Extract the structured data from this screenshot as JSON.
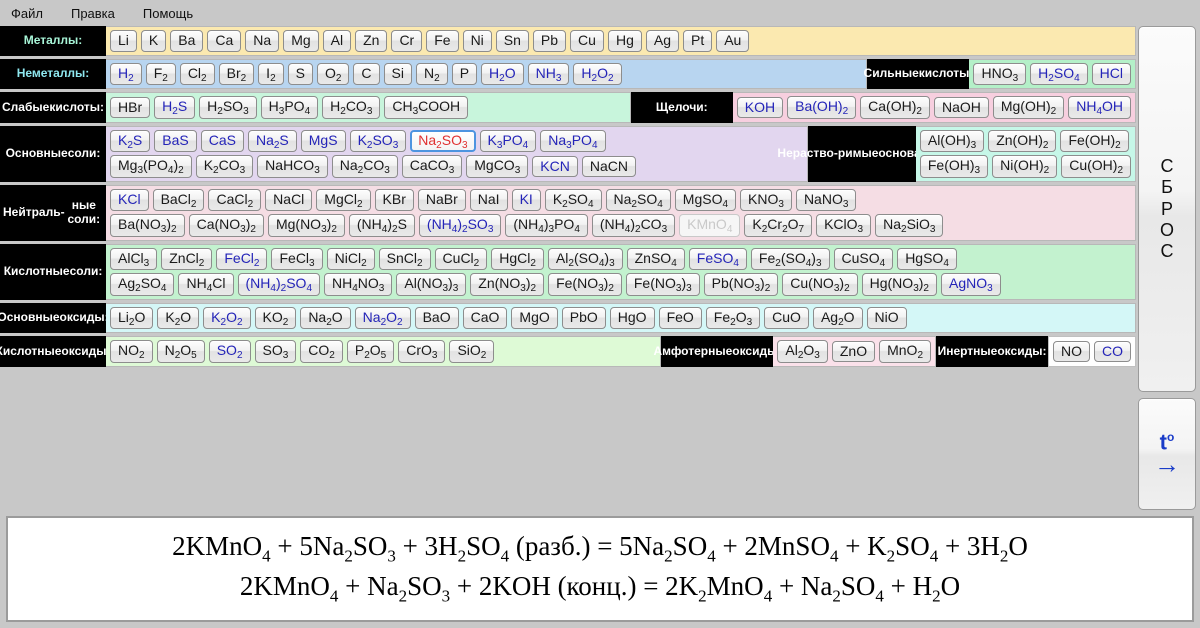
{
  "menu": {
    "items": [
      {
        "label": "Файл",
        "name": "menu-file"
      },
      {
        "label": "Правка",
        "name": "menu-edit"
      },
      {
        "label": "Помощь",
        "name": "menu-help"
      }
    ]
  },
  "side": {
    "reset_label": "СБРОС",
    "temp_label": "t°",
    "temp_arrow": "→"
  },
  "rows": [
    {
      "id": "metals",
      "label": "Металлы:",
      "label_color": "#a8f5d8",
      "zones": [
        {
          "tint": "#fbe9b0",
          "lines": [
            [
              "Li",
              "K",
              "Ba",
              "Ca",
              "Na",
              "Mg",
              "Al",
              "Zn",
              "Cr",
              "Fe",
              "Ni",
              "Sn",
              "Pb",
              "Cu",
              "Hg",
              "Ag",
              "Pt",
              "Au"
            ]
          ]
        }
      ]
    },
    {
      "id": "nonmetals",
      "label": "Неметаллы:",
      "label_color": "#8fe8f0",
      "zones": [
        {
          "tint": "#b8d5f0",
          "lines": [
            [
              "H2",
              "F2",
              "Cl2",
              "Br2",
              "I2",
              "S",
              "O2",
              "C",
              "Si",
              "N2",
              "P",
              "H2O",
              "NH3",
              "H2O2"
            ]
          ]
        },
        {
          "label": "Сильные\nкислоты:",
          "tint": "#b4f0c8",
          "lines": [
            [
              "HNO3",
              "H2SO4",
              "HCl"
            ]
          ]
        }
      ]
    },
    {
      "id": "weak-acids",
      "label": "Слабые\nкислоты:",
      "label_color": "#ffffff",
      "zones": [
        {
          "tint": "#c8f5dc",
          "lines": [
            [
              "HBr",
              "H2S",
              "H2SO3",
              "H3PO4",
              "H2CO3",
              "CH3COOH"
            ]
          ]
        },
        {
          "label": "Щелочи:",
          "tint": "#f7cfdf",
          "lines": [
            [
              "KOH",
              "Ba(OH)2",
              "Ca(OH)2",
              "NaOH",
              "Mg(OH)2",
              "NH4OH"
            ]
          ]
        }
      ]
    },
    {
      "id": "basic-salts",
      "label": "Основные\nсоли:",
      "label_color": "#ffffff",
      "zones": [
        {
          "tint": "#e2d6ef",
          "lines": [
            [
              "K2S",
              "BaS",
              "CaS",
              "Na2S",
              "MgS",
              "K2SO3",
              "Na2SO3",
              "K3PO4",
              "Na3PO4"
            ],
            [
              "Mg3(PO4)2",
              "K2CO3",
              "NaHCO3",
              "Na2CO3",
              "CaCO3",
              "MgCO3",
              "KCN",
              "NaCN"
            ]
          ]
        },
        {
          "label": "Нераство-\nримые\nоснования:",
          "tint": "#c6f7e8",
          "lines": [
            [
              "Al(OH)3",
              "Zn(OH)2",
              "Fe(OH)2"
            ],
            [
              "Fe(OH)3",
              "Ni(OH)2",
              "Cu(OH)2"
            ]
          ]
        }
      ]
    },
    {
      "id": "neutral-salts",
      "label": "Нейтраль-\nные соли:",
      "label_color": "#ffffff",
      "zones": [
        {
          "tint": "#f5dde4",
          "lines": [
            [
              "KCl",
              "BaCl2",
              "CaCl2",
              "NaCl",
              "MgCl2",
              "KBr",
              "NaBr",
              "NaI",
              "KI",
              "K2SO4",
              "Na2SO4",
              "MgSO4",
              "KNO3",
              "NaNO3"
            ],
            [
              "Ba(NO3)2",
              "Ca(NO3)2",
              "Mg(NO3)2",
              "(NH4)2S",
              "(NH4)2SO3",
              "(NH4)3PO4",
              "(NH4)2CO3",
              "KMnO4",
              "K2Cr2O7",
              "KClO3",
              "Na2SiO3"
            ]
          ]
        }
      ]
    },
    {
      "id": "acid-salts",
      "label": "Кислотные\nсоли:",
      "label_color": "#ffffff",
      "zones": [
        {
          "tint": "#c3f2cf",
          "lines": [
            [
              "AlCl3",
              "ZnCl2",
              "FeCl2",
              "FeCl3",
              "NiCl2",
              "SnCl2",
              "CuCl2",
              "HgCl2",
              "Al2(SO4)3",
              "ZnSO4",
              "FeSO4",
              "Fe2(SO4)3",
              "CuSO4",
              "HgSO4"
            ],
            [
              "Ag2SO4",
              "NH4Cl",
              "(NH4)2SO4",
              "NH4NO3",
              "Al(NO3)3",
              "Zn(NO3)2",
              "Fe(NO3)2",
              "Fe(NO3)3",
              "Pb(NO3)2",
              "Cu(NO3)2",
              "Hg(NO3)2",
              "AgNO3"
            ]
          ]
        }
      ]
    },
    {
      "id": "basic-oxides",
      "label": "Основные\nоксиды:",
      "label_color": "#ffffff",
      "zones": [
        {
          "tint": "#d4f7f7",
          "lines": [
            [
              "Li2O",
              "K2O",
              "K2O2",
              "KO2",
              "Na2O",
              "Na2O2",
              "BaO",
              "CaO",
              "MgO",
              "PbO",
              "HgO",
              "FeO",
              "Fe2O3",
              "CuO",
              "Ag2O",
              "NiO"
            ]
          ]
        }
      ]
    },
    {
      "id": "acid-oxides",
      "label": "Кислотные\nоксиды:",
      "label_color": "#ffffff",
      "zones": [
        {
          "tint": "#defad6",
          "lines": [
            [
              "NO2",
              "N2O5",
              "SO2",
              "SO3",
              "CO2",
              "P2O5",
              "CrO3",
              "SiO2"
            ]
          ]
        },
        {
          "label": "Амфотерные\nоксиды:",
          "tint": "#fbe1ea",
          "lines": [
            [
              "Al2O3",
              "ZnO",
              "MnO2"
            ]
          ]
        },
        {
          "label": "Инертные\nоксиды:",
          "tint": "#ffffff",
          "lines": [
            [
              "NO",
              "CO"
            ]
          ]
        }
      ]
    }
  ],
  "highlighted": {
    "selected_red": [
      "Na2SO3"
    ],
    "blue_text": [
      "H2",
      "H2O",
      "NH3",
      "H2O2",
      "H2SO4",
      "HCl",
      "H2S",
      "KOH",
      "Ba(OH)2",
      "NH4OH",
      "K2S",
      "BaS",
      "CaS",
      "Na2S",
      "MgS",
      "K2SO3",
      "K3PO4",
      "Na3PO4",
      "KCN",
      "KCl",
      "(NH4)2SO3",
      "FeCl2",
      "(NH4)2SO4",
      "FeSO4",
      "AgNO3",
      "K2O2",
      "Na2O2",
      "SO2",
      "CO",
      "KI"
    ],
    "pressed": [
      "KMnO4"
    ]
  },
  "equations": {
    "line1": "2KMnO4 + 5Na2SO3 + 3H2SO4 (разб.) = 5Na2SO4 + 2MnSO4 + K2SO4 + 3H2O",
    "line2": "2KMnO4 + Na2SO3 + 2KOH (конц.) = 2K2MnO4 + Na2SO4 + H2O"
  }
}
